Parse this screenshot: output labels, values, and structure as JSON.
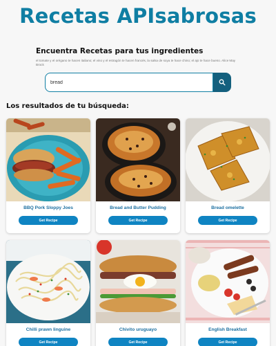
{
  "header": {
    "title": "Recetas APIsabrosas"
  },
  "search_section": {
    "title": "Encuentra Recetas para tus ingredientes",
    "hint": "el tomate y el orégano te hacen italiano; el vino y el estragón te hacen francés, la salsa de soya te hace chino; el ajo te hace bueno. Alice May Brock",
    "input_value": "bread",
    "button_icon": "search-icon"
  },
  "results": {
    "title": "Los resultados de tu búsqueda:",
    "button_label": "Get Recipe",
    "button_color": "#0f84c2",
    "recipes": [
      {
        "name": "BBQ Pork Sloppy Joes"
      },
      {
        "name": "Bread and Butter Pudding"
      },
      {
        "name": "Bread omelette"
      },
      {
        "name": "Chilli prawn linguine"
      },
      {
        "name": "Chivito uruguayo"
      },
      {
        "name": "English Breakfast"
      }
    ]
  },
  "colors": {
    "title": "#0f7ea3",
    "search_button": "#14607e",
    "accent": "#1c6fa0"
  }
}
